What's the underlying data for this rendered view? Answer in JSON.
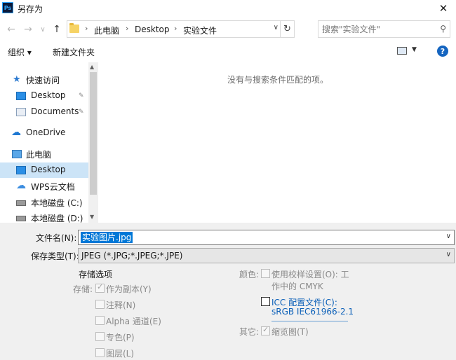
{
  "window": {
    "icon_label": "Ps",
    "title": "另存为",
    "close_glyph": "✕"
  },
  "nav": {
    "back_glyph": "←",
    "forward_glyph": "→",
    "history_glyph": "∨",
    "up_glyph": "↑",
    "breadcrumb": [
      "此电脑",
      "Desktop",
      "实验文件"
    ],
    "separator_glyph": "›",
    "dropdown_glyph": "∨",
    "refresh_glyph": "↻",
    "search_placeholder": "搜索\"实验文件\"",
    "search_glyph": "⚲"
  },
  "toolbar": {
    "organize_label": "组织 ▾",
    "new_folder_label": "新建文件夹",
    "view_dropdown_glyph": "▼",
    "help_glyph": "?"
  },
  "sidebar": {
    "items": [
      {
        "label": "快速访问",
        "icon": "star-icon",
        "pinned": false
      },
      {
        "label": "Desktop",
        "icon": "desktop-icon",
        "pinned": true
      },
      {
        "label": "Documents",
        "icon": "documents-icon",
        "pinned": true
      },
      {
        "label": "OneDrive",
        "icon": "cloud-icon",
        "pinned": false
      },
      {
        "label": "此电脑",
        "icon": "computer-icon",
        "pinned": false
      },
      {
        "label": "Desktop",
        "icon": "desktop-icon",
        "pinned": false,
        "selected": true
      },
      {
        "label": "WPS云文档",
        "icon": "wps-cloud-icon",
        "pinned": false
      },
      {
        "label": "本地磁盘 (C:)",
        "icon": "drive-icon",
        "pinned": false
      },
      {
        "label": "本地磁盘 (D:)",
        "icon": "drive-icon",
        "pinned": false
      }
    ],
    "pin_glyph": "📌",
    "scroll_up_glyph": "▲",
    "scroll_down_glyph": "▼"
  },
  "content": {
    "empty_message": "没有与搜索条件匹配的项。"
  },
  "form": {
    "filename_label": "文件名(N):",
    "filename_value": "实验图片.jpg",
    "filetype_label": "保存类型(T):",
    "filetype_value": "JPEG (*.JPG;*.JPEG;*.JPE)",
    "dropdown_glyph": "∨"
  },
  "save_options": {
    "title": "存储选项",
    "save_label": "存储:",
    "as_copy": "作为副本(Y)",
    "annotations": "注释(N)",
    "alpha": "Alpha 通道(E)",
    "spot": "专色(P)",
    "layers": "图层(L)",
    "check_glyph": "✓"
  },
  "color_options": {
    "color_label": "颜色:",
    "proof_setup_line1": "使用校样设置(O):  工",
    "proof_setup_line2": "作中的 CMYK",
    "icc_line1": "ICC 配置文件(C):",
    "icc_line2": "sRGB IEC61966-2.1",
    "other_label": "其它:",
    "thumbnail": "缩览图(T)"
  },
  "colors": {
    "accent": "#0078d7",
    "selection_bg": "#cce4f7",
    "link": "#0a5fb8",
    "dialog_bg": "#f0f0f0"
  }
}
